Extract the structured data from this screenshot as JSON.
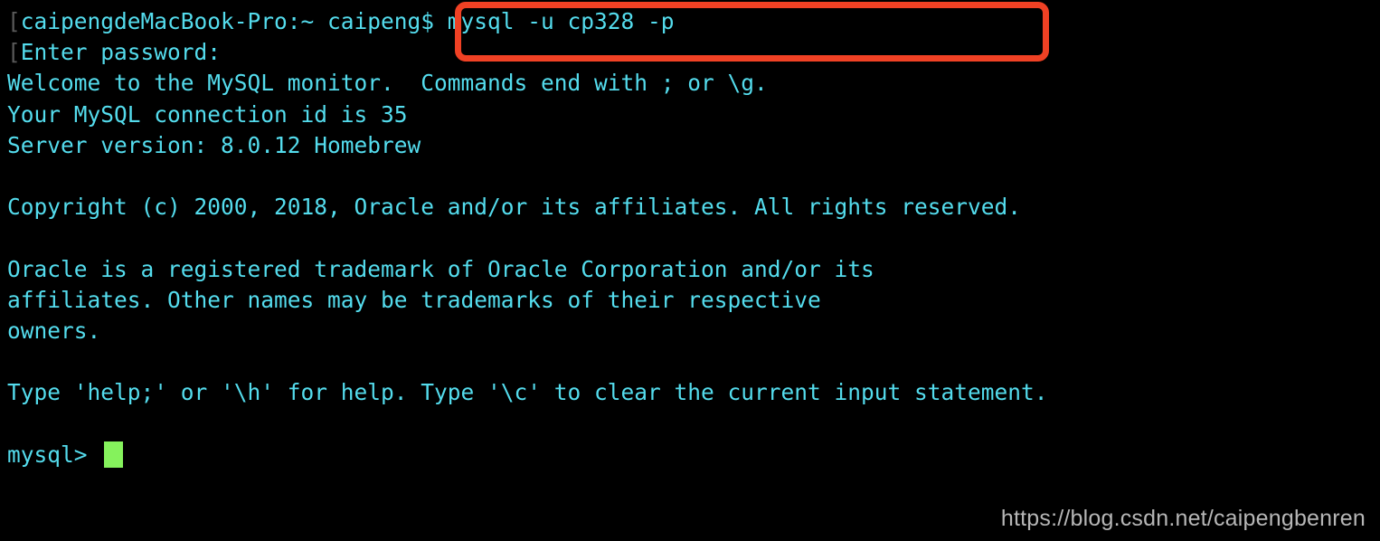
{
  "window": {
    "title": "caipengdeMacBook-Pro — mysql",
    "background_color": "#000000",
    "foreground_color": "#54dced",
    "cursor_color": "#85f25c",
    "dim_color": "#5a5a5a",
    "highlight_color": "#f04124"
  },
  "terminal": {
    "shell_prompt_bracket": "[",
    "lines": [
      {
        "id": "prompt-command-line",
        "bracket": "[",
        "text": "caipengdeMacBook-Pro:~ caipeng$ mysql -u cp328 -p",
        "type": "command"
      },
      {
        "id": "password-prompt-line",
        "bracket": "[",
        "text": "Enter password:",
        "type": "prompt"
      },
      {
        "id": "welcome-line",
        "bracket": "",
        "text": "Welcome to the MySQL monitor.  Commands end with ; or \\g.",
        "type": "output"
      },
      {
        "id": "connection-id-line",
        "bracket": "",
        "text": "Your MySQL connection id is 35",
        "type": "output"
      },
      {
        "id": "server-version-line",
        "bracket": "",
        "text": "Server version: 8.0.12 Homebrew",
        "type": "output"
      },
      {
        "id": "blank-line-1",
        "bracket": "",
        "text": "",
        "type": "blank"
      },
      {
        "id": "copyright-line",
        "bracket": "",
        "text": "Copyright (c) 2000, 2018, Oracle and/or its affiliates. All rights reserved.",
        "type": "output"
      },
      {
        "id": "blank-line-2",
        "bracket": "",
        "text": "",
        "type": "blank"
      },
      {
        "id": "trademark-line-1",
        "bracket": "",
        "text": "Oracle is a registered trademark of Oracle Corporation and/or its",
        "type": "output"
      },
      {
        "id": "trademark-line-2",
        "bracket": "",
        "text": "affiliates. Other names may be trademarks of their respective",
        "type": "output"
      },
      {
        "id": "trademark-line-3",
        "bracket": "",
        "text": "owners.",
        "type": "output"
      },
      {
        "id": "blank-line-3",
        "bracket": "",
        "text": "",
        "type": "blank"
      },
      {
        "id": "help-hint-line",
        "bracket": "",
        "text": "Type 'help;' or '\\h' for help. Type '\\c' to clear the current input statement.",
        "type": "output"
      },
      {
        "id": "blank-line-4",
        "bracket": "",
        "text": "",
        "type": "blank"
      }
    ],
    "mysql_prompt": "mysql> ",
    "command": {
      "host_user": "caipengdeMacBook-Pro:~ caipeng$",
      "typed": "mysql -u cp328 -p",
      "mysql_user": "cp328"
    },
    "session": {
      "connection_id": "35",
      "server_version": "8.0.12",
      "server_distribution": "Homebrew",
      "statement_terminators": "; or \\g"
    }
  },
  "annotation": {
    "highlight_label": "mysql-login-command-highlight",
    "color": "#f04124"
  },
  "watermark": {
    "text": "https://blog.csdn.net/caipengbenren"
  }
}
